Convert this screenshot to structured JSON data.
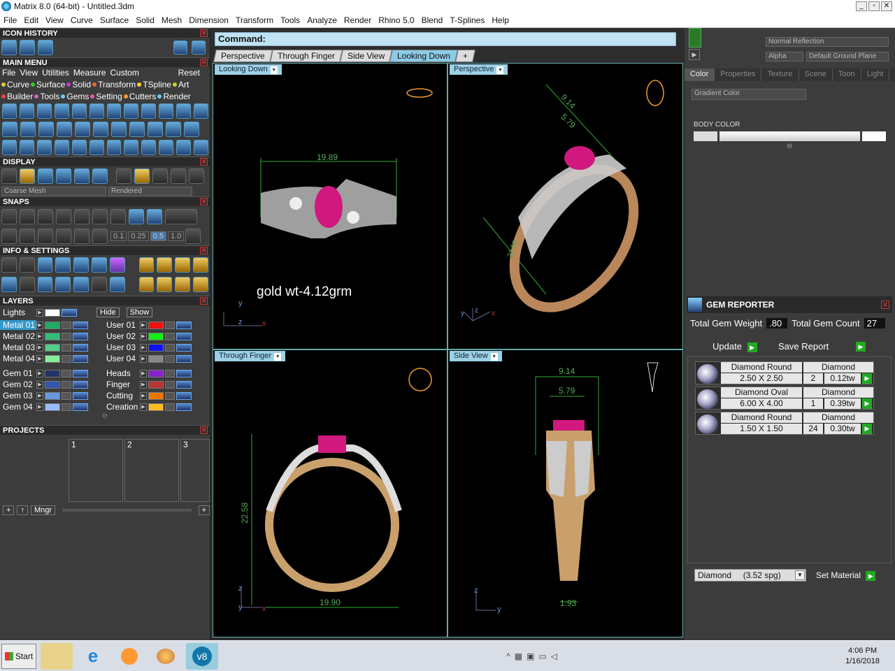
{
  "window": {
    "title": "Matrix 8.0 (64-bit) - Untitled.3dm"
  },
  "menu": [
    "File",
    "Edit",
    "View",
    "Curve",
    "Surface",
    "Solid",
    "Mesh",
    "Dimension",
    "Transform",
    "Tools",
    "Analyze",
    "Render",
    "Rhino 5.0",
    "Blend",
    "T-Splines",
    "Help"
  ],
  "left": {
    "icon_history": "ICON HISTORY",
    "main_menu": "MAIN MENU",
    "mm_items": [
      "File",
      "View",
      "Utilities",
      "Measure",
      "Custom"
    ],
    "reset": "Reset",
    "cat_row1": [
      "Curve",
      "Surface",
      "Solid",
      "Transform",
      "TSpline",
      "Art"
    ],
    "cat_row2": [
      "Builder",
      "Tools",
      "Gems",
      "Setting",
      "Cutters",
      "Render"
    ],
    "display": "DISPLAY",
    "display_mesh": "Coarse Mesh",
    "display_mode": "Rendered",
    "snaps": "SNAPS",
    "snap_vals": [
      "0.1",
      "0.25",
      "0.5",
      "1.0"
    ],
    "info": "INFO & SETTINGS",
    "layers": "LAYERS",
    "lights": "Lights",
    "hide": "Hide",
    "show": "Show",
    "metal": [
      "Metal 01",
      "Metal 02",
      "Metal 03",
      "Metal 04"
    ],
    "user": [
      "User 01",
      "User 02",
      "User 03",
      "User 04"
    ],
    "gem": [
      "Gem 01",
      "Gem 02",
      "Gem 03",
      "Gem 04"
    ],
    "misc": [
      "Heads",
      "Finger",
      "Cutting",
      "Creation"
    ],
    "projects": "PROJECTS",
    "proj_slots": [
      "1",
      "2",
      "3"
    ],
    "mngr": "Mngr"
  },
  "center": {
    "command": "Command:",
    "tabs": [
      "Perspective",
      "Through Finger",
      "Side View",
      "Looking Down"
    ],
    "vp_tl": "Looking Down",
    "vp_tr": "Perspective",
    "vp_bl": "Through Finger",
    "vp_br": "Side View",
    "gold_note": "gold wt-4.12grm",
    "dims": {
      "top_width": "19.89",
      "persp_a": "9.14",
      "persp_b": "5.79",
      "persp_c": "22.58",
      "finger_h": "22.58",
      "finger_w": "19.90",
      "side_a": "9.14",
      "side_b": "5.79",
      "side_c": "1.93"
    },
    "axes": {
      "y": "y",
      "x": "x",
      "z": "z"
    }
  },
  "right": {
    "reflection": "Normal Reflection",
    "alpha": "Alpha",
    "ground": "Default Ground Plane",
    "tabs": [
      "Color",
      "Properties",
      "Texture",
      "Scene",
      "Toon",
      "Light"
    ],
    "gradient": "Gradient Color",
    "body_color": "BODY COLOR",
    "gem_reporter": "GEM REPORTER",
    "total_weight_lbl": "Total Gem Weight",
    "total_weight": ".80",
    "total_count_lbl": "Total Gem Count",
    "total_count": "27",
    "update": "Update",
    "save_report": "Save Report",
    "gems": [
      {
        "name": "Diamond Round",
        "size": "2.50 X 2.50",
        "mat": "Diamond",
        "qty": "2",
        "tw": "0.12tw"
      },
      {
        "name": "Diamond Oval",
        "size": "6.00 X 4.00",
        "mat": "Diamond",
        "qty": "1",
        "tw": "0.39tw"
      },
      {
        "name": "Diamond Round",
        "size": "1.50 X 1.50",
        "mat": "Diamond",
        "qty": "24",
        "tw": "0.30tw"
      }
    ],
    "material_select": "Diamond     (3.52 spg)",
    "set_material": "Set Material"
  },
  "taskbar": {
    "start": "Start",
    "time": "4:06 PM",
    "date": "1/16/2018"
  }
}
